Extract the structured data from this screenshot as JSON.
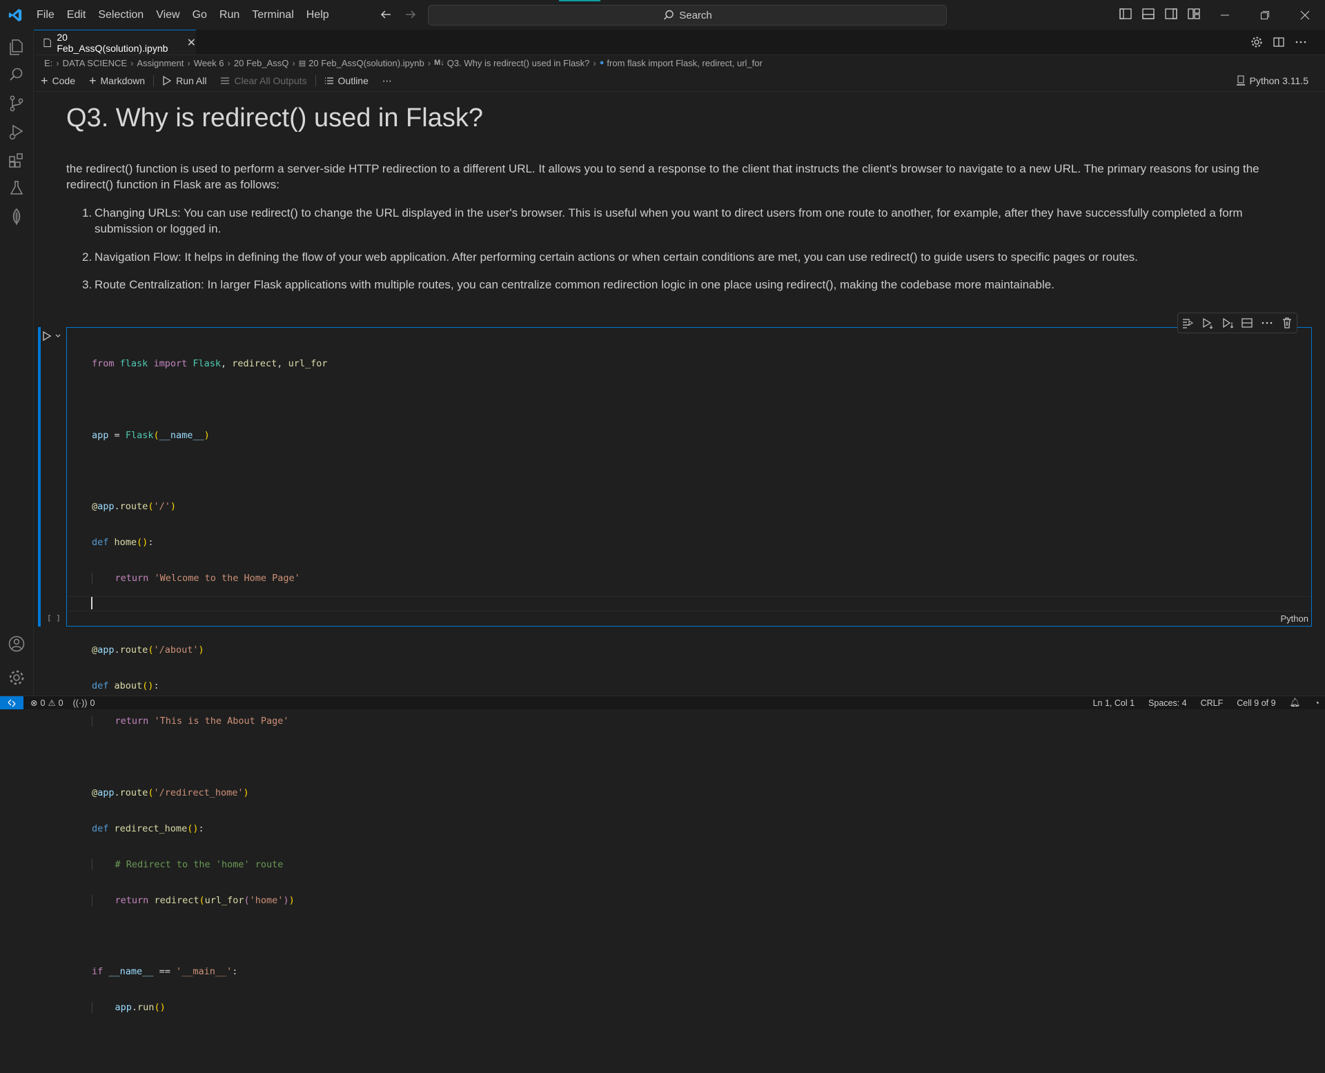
{
  "menu": [
    "File",
    "Edit",
    "Selection",
    "View",
    "Go",
    "Run",
    "Terminal",
    "Help"
  ],
  "search": {
    "label": "Search"
  },
  "tab": {
    "title": "20 Feb_AssQ(solution).ipynb"
  },
  "breadcrumb": [
    "E:",
    "DATA SCIENCE",
    "Assignment",
    "Week 6",
    "20 Feb_AssQ",
    "20 Feb_AssQ(solution).ipynb",
    "Q3. Why is redirect() used in Flask?",
    "from flask import Flask, redirect, url_for"
  ],
  "toolbar": {
    "code": "Code",
    "markdown": "Markdown",
    "run_all": "Run All",
    "clear_outputs": "Clear All Outputs",
    "outline": "Outline",
    "more": "⋯",
    "kernel": "Python 3.11.5"
  },
  "markdown_cell": {
    "heading": "Q3. Why is redirect() used in Flask?",
    "intro_line1": "the redirect() function is used to perform a server-side HTTP redirection to a different URL. It allows you to send a response to the client that instructs the client's browser to navigate to a new URL. The primary reasons for using the",
    "intro_line2": "redirect() function in Flask are as follows:",
    "items": [
      {
        "num": "1.",
        "line1": "Changing URLs: You can use redirect() to change the URL displayed in the user's browser. This is useful when you want to direct users from one route to another, for example, after they have successfully completed a form",
        "line2": "submission or logged in."
      },
      {
        "num": "2.",
        "line1": "Navigation Flow: It helps in defining the flow of your web application. After performing certain actions or when certain conditions are met, you can use redirect() to guide users to specific pages or routes."
      },
      {
        "num": "3.",
        "line1": "Route Centralization: In larger Flask applications with multiple routes, you can centralize common redirection logic in one place using redirect(), making the codebase more maintainable."
      }
    ]
  },
  "code_cell": {
    "execution_count": "[ ]",
    "language": "Python"
  },
  "statusbar": {
    "errors": "0",
    "warnings": "0",
    "ports": "0",
    "position": "Ln 1, Col 1",
    "spaces": "Spaces: 4",
    "eol": "CRLF",
    "cell": "Cell 9 of 9"
  },
  "colors": {
    "accent": "#0078d4",
    "background": "#1f1f1f"
  }
}
